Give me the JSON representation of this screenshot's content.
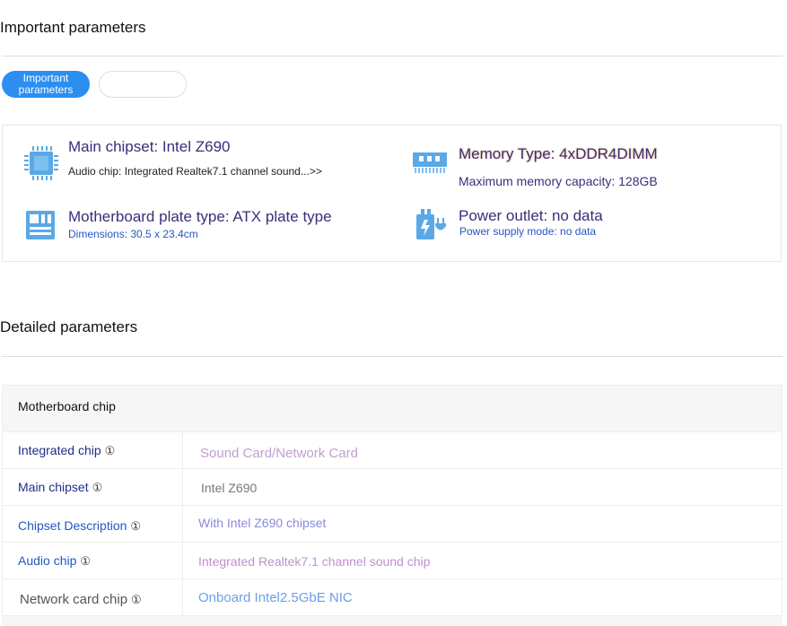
{
  "important": {
    "heading": "Important parameters",
    "tabs": [
      {
        "label": "Important parameters"
      },
      {
        "label": ""
      }
    ]
  },
  "cards": {
    "chipset": {
      "title": "Main chipset: Intel Z690",
      "sub": "Audio chip: Integrated Realtek7.1 channel sound...>>"
    },
    "memory": {
      "title": "Memory Type: 4xDDR4DIMM",
      "sub": "Maximum memory capacity: 128GB"
    },
    "board": {
      "title": "Motherboard plate type: ATX plate type",
      "sub": "Dimensions: 30.5 x 23.4cm"
    },
    "power": {
      "title": "Power outlet: no data",
      "sub": "Power supply mode: no data"
    }
  },
  "detailed": {
    "heading": "Detailed parameters",
    "section": "Motherboard chip",
    "info_symbol": "①",
    "rows": [
      {
        "key": "Integrated chip",
        "value": "Sound Card/Network Card"
      },
      {
        "key": "Main chipset",
        "value": "Intel Z690"
      },
      {
        "key": "Chipset Description",
        "value": "With Intel Z690 chipset"
      },
      {
        "key": "Audio chip",
        "value": "Integrated Realtek7.1 channel sound chip"
      },
      {
        "key": "Network card chip",
        "value": "Onboard Intel2.5GbE NIC"
      }
    ]
  },
  "colors": {
    "accent": "#2b8ef0",
    "icon": "#5aa9e6",
    "title": "#3a2e7a",
    "key": "#1d2e86"
  }
}
